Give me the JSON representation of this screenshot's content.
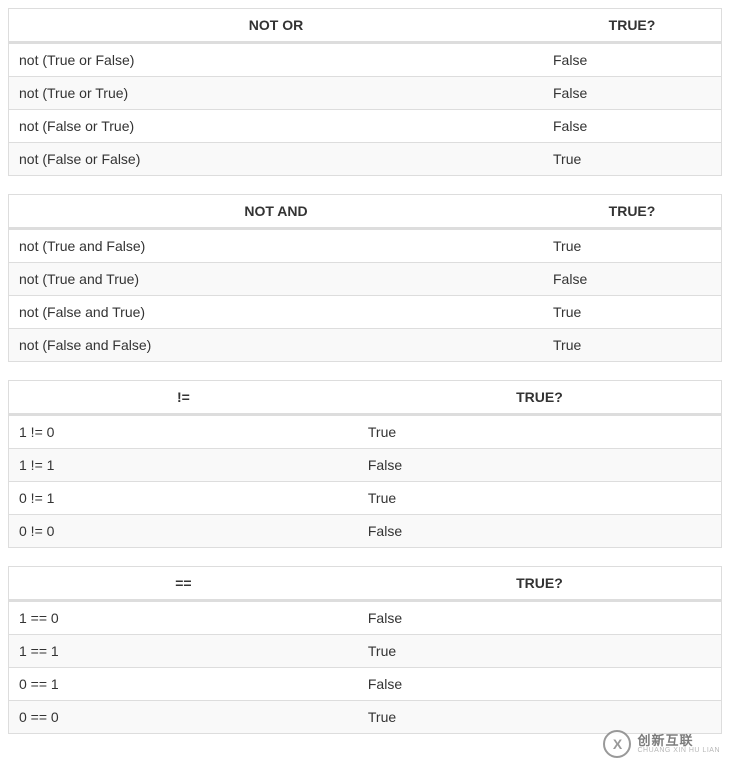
{
  "tables": [
    {
      "layout": "wide",
      "headers": [
        "NOT OR",
        "TRUE?"
      ],
      "rows": [
        [
          "not (True or False)",
          "False"
        ],
        [
          "not (True or True)",
          "False"
        ],
        [
          "not (False or True)",
          "False"
        ],
        [
          "not (False or False)",
          "True"
        ]
      ]
    },
    {
      "layout": "wide",
      "headers": [
        "NOT AND",
        "TRUE?"
      ],
      "rows": [
        [
          "not (True and False)",
          "True"
        ],
        [
          "not (True and True)",
          "False"
        ],
        [
          "not (False and True)",
          "True"
        ],
        [
          "not (False and False)",
          "True"
        ]
      ]
    },
    {
      "layout": "half",
      "headers": [
        "!=",
        "TRUE?"
      ],
      "rows": [
        [
          "1 != 0",
          "True"
        ],
        [
          "1 != 1",
          "False"
        ],
        [
          "0 != 1",
          "True"
        ],
        [
          "0 != 0",
          "False"
        ]
      ]
    },
    {
      "layout": "half",
      "headers": [
        "==",
        "TRUE?"
      ],
      "rows": [
        [
          "1 == 0",
          "False"
        ],
        [
          "1 == 1",
          "True"
        ],
        [
          "0 == 1",
          "False"
        ],
        [
          "0 == 0",
          "True"
        ]
      ]
    }
  ],
  "watermark": {
    "symbol": "X",
    "cn": "创新互联",
    "py": "CHUANG XIN HU LIAN"
  }
}
